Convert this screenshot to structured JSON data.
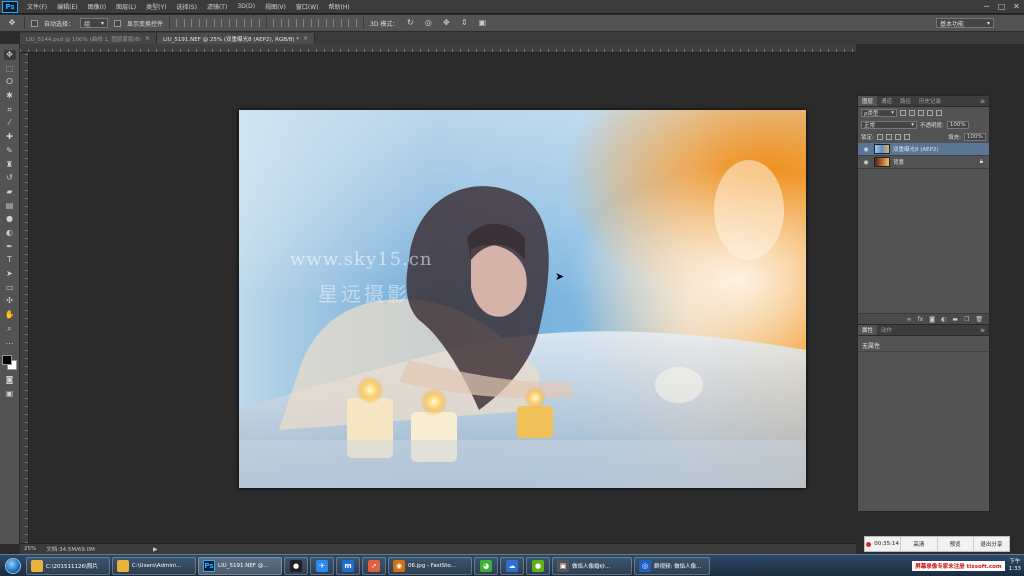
{
  "menubar": {
    "logo": "Ps",
    "items": [
      "文件(F)",
      "编辑(E)",
      "图像(I)",
      "图层(L)",
      "类型(Y)",
      "选择(S)",
      "滤镜(T)",
      "3D(D)",
      "视图(V)",
      "窗口(W)",
      "帮助(H)"
    ],
    "minimize": "─",
    "maximize": "□",
    "close": "✕"
  },
  "optbar": {
    "auto_select_label": "自动选择：",
    "auto_select_value": "组",
    "show_transform_label": "显示变换控件",
    "mode_3d_label": "3D 模式：",
    "workspace": "基本功能"
  },
  "tabs": [
    {
      "label": "LIU_5144.psd @ 100% (曲线 1, 图层蒙版/8)",
      "close": "×"
    },
    {
      "label": "LIU_5191.NEF @ 25% (双重曝光8 (AEP2), RGB/8) *",
      "close": "×"
    }
  ],
  "canvas": {
    "watermark_url": "www.sky15.cn",
    "watermark_cn": "星远摄影"
  },
  "statusbar": {
    "zoom": "25%",
    "doc_info": "文档:34.5M/69.0M",
    "arrow": "▶"
  },
  "layers_panel": {
    "tabs": [
      "图层",
      "通道",
      "路径",
      "历史记录"
    ],
    "filter_label": "ρ类型",
    "blend_mode": "正常",
    "opacity_label": "不透明度:",
    "opacity_value": "100%",
    "lock_label": "锁定:",
    "fill_label": "填充:",
    "fill_value": "100%",
    "layers": [
      {
        "name": "双重曝光8 (AEP2)",
        "selected": true
      },
      {
        "name": "背景",
        "selected": false
      }
    ],
    "footer_icons": [
      "link-icon",
      "fx-icon",
      "mask-icon",
      "adjustment-icon",
      "folder-icon",
      "new-layer-icon",
      "trash-icon"
    ]
  },
  "properties_panel": {
    "tabs": [
      "属性",
      "动作"
    ],
    "empty_text": "无属性"
  },
  "recording": {
    "time": "00:35:14",
    "quality": "高清",
    "preview": "预览",
    "exit_share": "退出分享"
  },
  "taskbar": {
    "items": [
      {
        "label": "C:\\201511126\\照片",
        "icon": "folder-icon",
        "color": "#e8b23a"
      },
      {
        "label": "C:\\Users\\Admini...",
        "icon": "folder-icon",
        "color": "#e8b23a"
      },
      {
        "label": "LIU_5191.NEF @...",
        "icon": "photoshop-icon",
        "color": "#0a1e33",
        "glyph": "Ps",
        "active": true
      },
      {
        "label": "",
        "icon": "qq-icon",
        "color": "#222"
      },
      {
        "label": "",
        "icon": "feather-icon",
        "color": "#2d89ef"
      },
      {
        "label": "",
        "icon": "m-app-icon",
        "color": "#1e6fd0"
      },
      {
        "label": "",
        "icon": "arrow-app-icon",
        "color": "#e06040"
      },
      {
        "label": "06.jpg - FastSto...",
        "icon": "eye-app-icon",
        "color": "#d07010"
      },
      {
        "label": "",
        "icon": "wechat-icon",
        "color": "#3cb034"
      },
      {
        "label": "",
        "icon": "sync-icon",
        "color": "#2d6fd0"
      },
      {
        "label": "",
        "icon": "green-app-icon",
        "color": "#60b020"
      },
      {
        "label": "做馅人像婚纱...",
        "icon": "photo-app-icon",
        "color": "#333"
      },
      {
        "label": "群视频: 做馅人像...",
        "icon": "video-app-icon",
        "color": "#2060c0"
      }
    ],
    "tray_banner": "屏幕录像专家未注册 tlxsoft.com",
    "clock_line1": "下午",
    "clock_line2": "1:33"
  }
}
